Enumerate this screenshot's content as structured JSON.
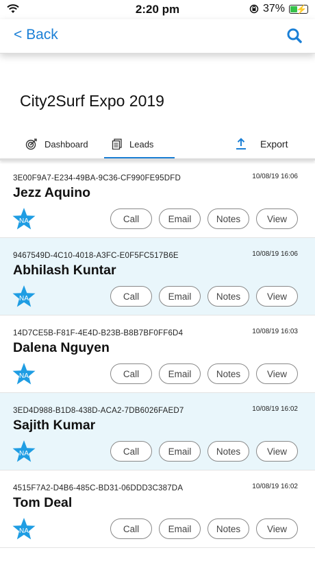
{
  "status_bar": {
    "time": "2:20 pm",
    "battery_percent": "37%"
  },
  "nav": {
    "back_label": "< Back"
  },
  "event_title": "City2Surf Expo 2019",
  "tabs": [
    {
      "label": "Dashboard",
      "icon": "target-icon"
    },
    {
      "label": "Leads",
      "icon": "document-icon",
      "active": true
    },
    {
      "label": "Export",
      "icon": "upload-icon"
    }
  ],
  "buttons": {
    "call": "Call",
    "email": "Email",
    "notes": "Notes",
    "view": "View"
  },
  "badge_text": "NA",
  "leads": [
    {
      "id": "3E00F9A7-E234-49BA-9C36-CF990FE95DFD",
      "name": "Jezz Aquino",
      "timestamp": "10/08/19 16:06"
    },
    {
      "id": "9467549D-4C10-4018-A3FC-E0F5FC517B6E",
      "name": "Abhilash Kuntar",
      "timestamp": "10/08/19 16:06"
    },
    {
      "id": "14D7CE5B-F81F-4E4D-B23B-B8B7BF0FF6D4",
      "name": "Dalena Nguyen",
      "timestamp": "10/08/19 16:03"
    },
    {
      "id": "3ED4D988-B1D8-438D-ACA2-7DB6026FAED7",
      "name": "Sajith Kumar",
      "timestamp": "10/08/19 16:02"
    },
    {
      "id": "4515F7A2-D4B6-485C-BD31-06DDD3C387DA",
      "name": "Tom Deal",
      "timestamp": "10/08/19 16:02"
    }
  ],
  "colors": {
    "accent": "#1a7fd6",
    "alt_row": "#e9f6fb",
    "star": "#1f9de3",
    "battery": "#36c24a"
  }
}
